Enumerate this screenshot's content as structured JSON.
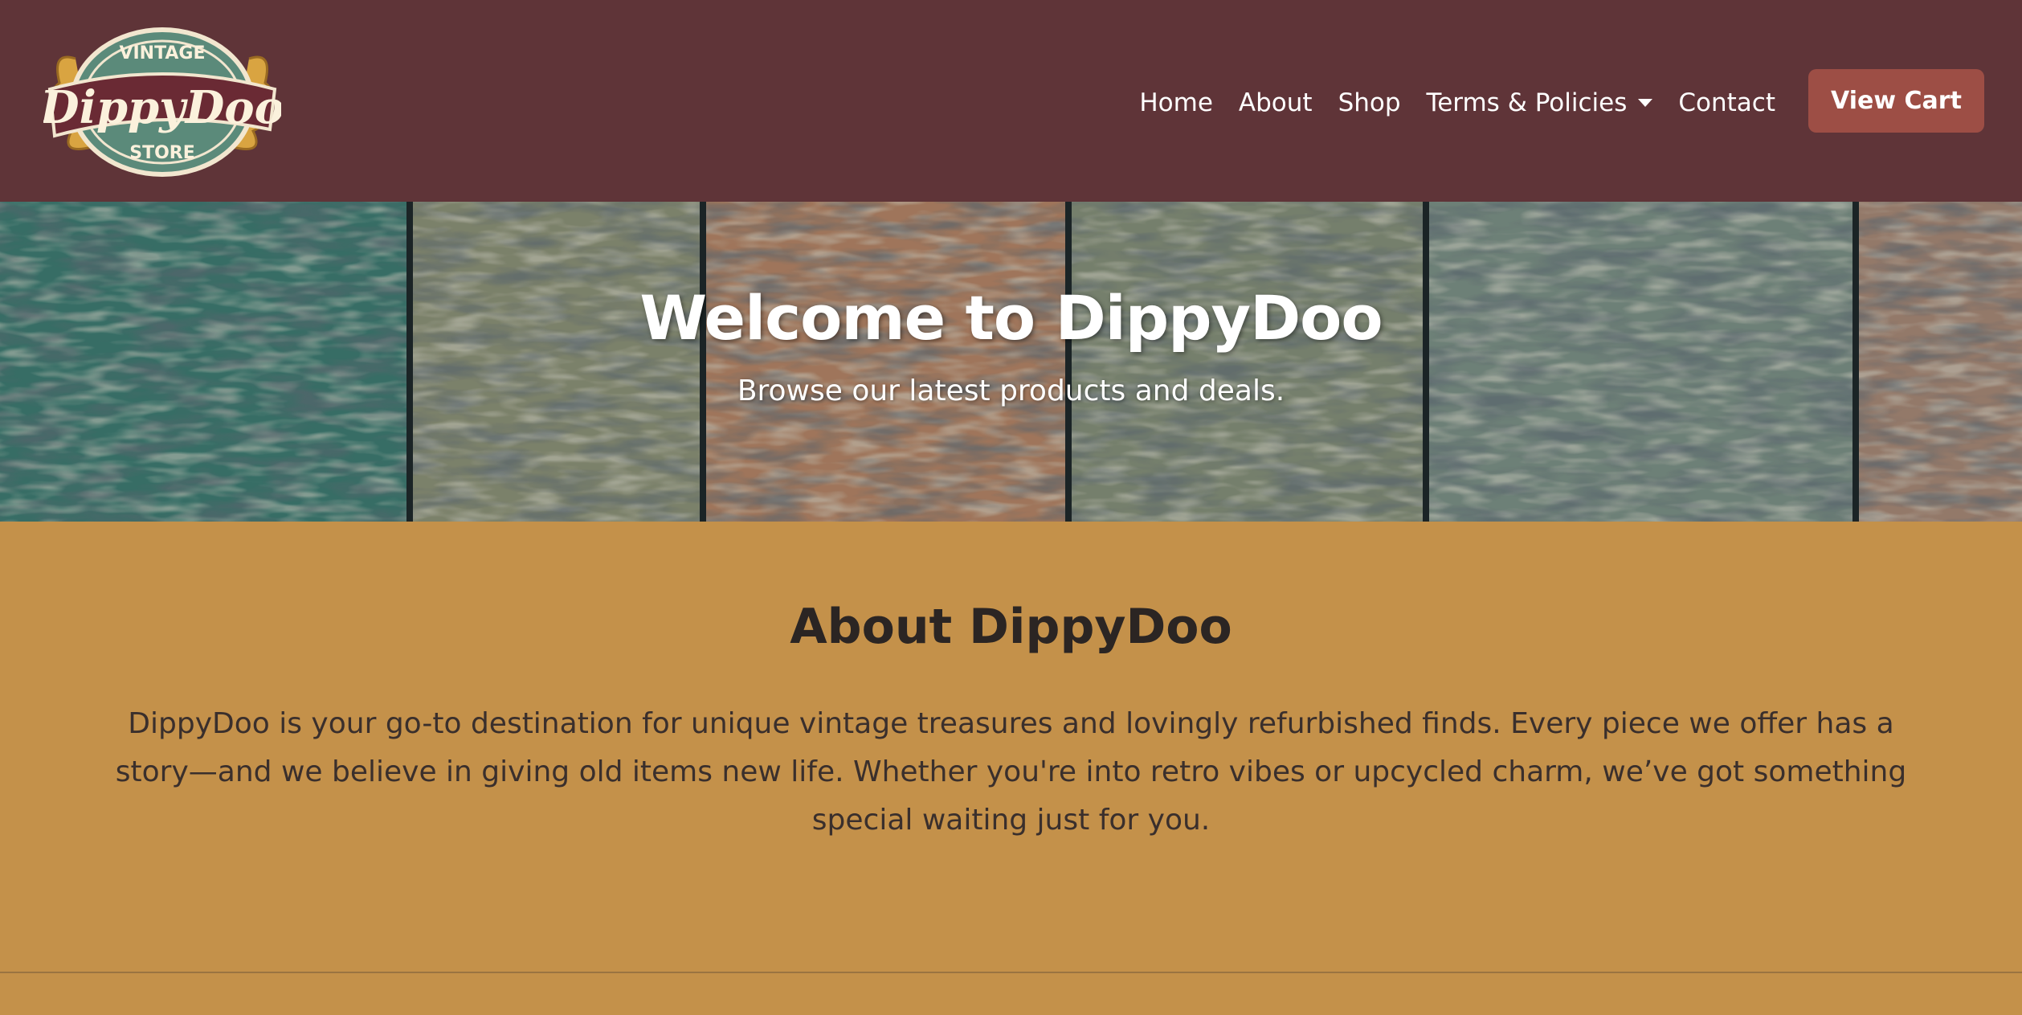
{
  "brand": {
    "logo_top": "VINTAGE",
    "logo_main": "DippyDoo",
    "logo_bottom": "STORE"
  },
  "nav": {
    "items": [
      "Home",
      "About",
      "Shop",
      "Terms & Policies",
      "Contact"
    ],
    "dropdown_icon": "caret-down-icon",
    "cart_label": "View Cart"
  },
  "hero": {
    "title": "Welcome to DippyDoo",
    "subtitle": "Browse our latest products and deals."
  },
  "about": {
    "title": "About DippyDoo",
    "text": "DippyDoo is your go-to destination for unique vintage treasures and lovingly refurbished finds. Every piece we offer has a story—and we believe in giving old items new life. Whether you're into retro vibes or upcycled charm, we’ve got something special waiting just for you."
  },
  "colors": {
    "navbar": "#5f3438",
    "cart_button": "#9d4e45",
    "about_background": "#c4914a",
    "logo_teal": "#5b8a7a",
    "logo_maroon": "#6a2a34",
    "logo_gold": "#d9a441"
  }
}
